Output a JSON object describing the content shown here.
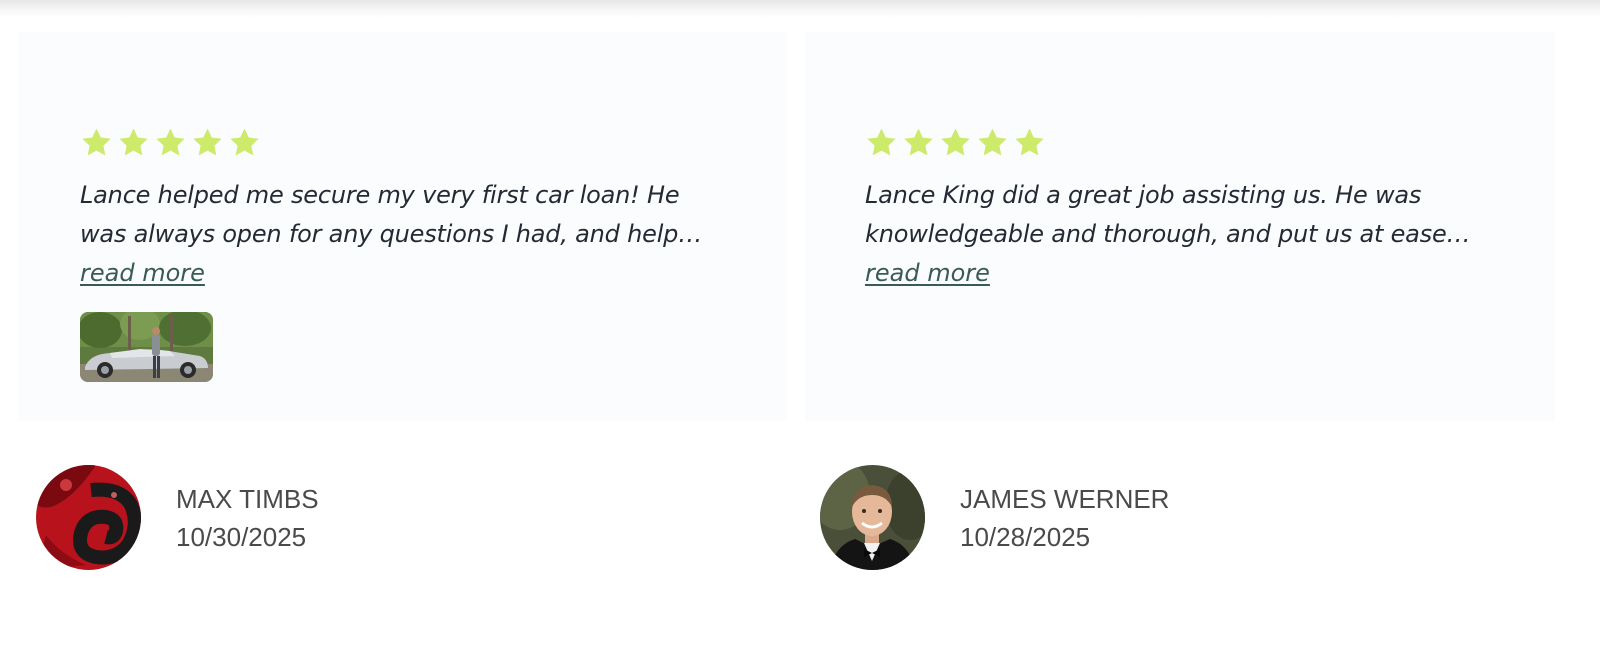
{
  "colors": {
    "star": "#cdea6a",
    "card_bg": "#fbfcfe",
    "link": "#3a5a55",
    "text": "#232a33",
    "meta_text": "#4a4a4a"
  },
  "reviews": [
    {
      "rating": 5,
      "text": "Lance helped me secure my very first car loan! He was always open for any questions I had, and help…",
      "read_more": "read more",
      "has_photo": true,
      "author": {
        "name": "MAX TIMBS",
        "date": "10/30/2025"
      }
    },
    {
      "rating": 5,
      "text": "Lance King did a great job assisting us. He was knowledgeable and thorough, and put us at ease…",
      "read_more": "read more",
      "has_photo": false,
      "author": {
        "name": "JAMES WERNER",
        "date": "10/28/2025"
      }
    }
  ],
  "icons": {
    "star": "star-icon"
  }
}
